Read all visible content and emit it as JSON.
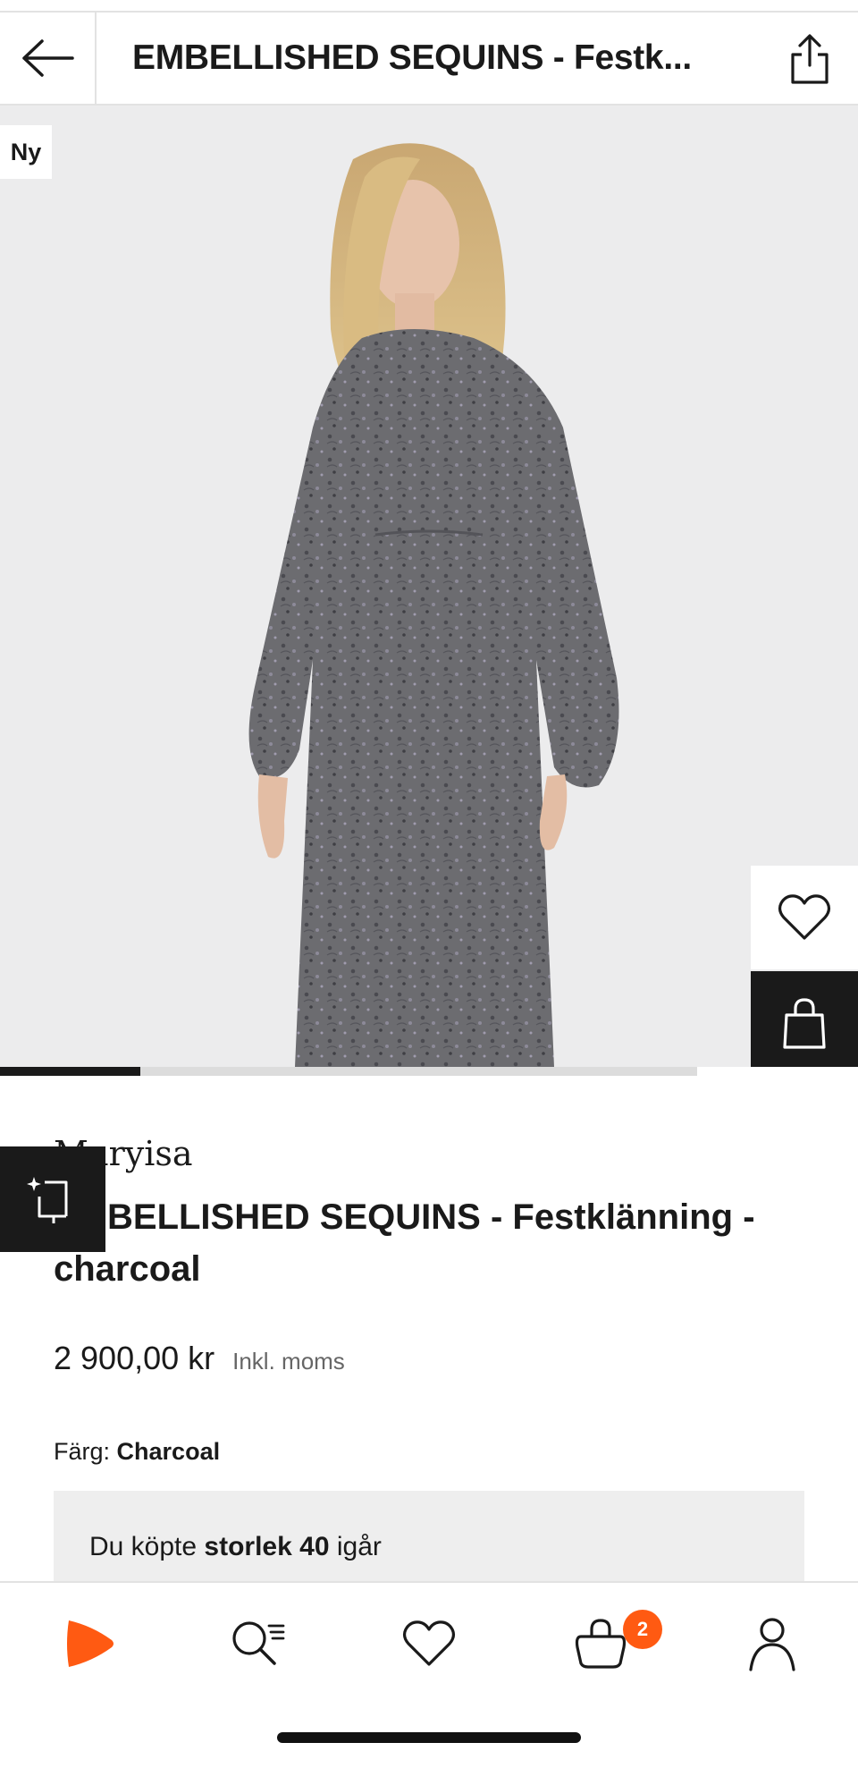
{
  "header": {
    "title": "EMBELLISHED SEQUINS - Festk...",
    "back_icon": "arrow-left-icon",
    "share_icon": "share-icon"
  },
  "gallery": {
    "badge": "Ny",
    "image_alt": "Model wearing charcoal embellished sequin long-sleeve maxi dress",
    "dress_color": "#6c6c70",
    "progress": 0.2
  },
  "product": {
    "brand": "Maryisa",
    "name": "EMBELLISHED SEQUINS - Festklänning - charcoal",
    "price": "2 900,00 kr",
    "vat_label": "Inkl. moms",
    "color_label": "Färg:",
    "color_value": "Charcoal",
    "bought_prefix": "Du köpte ",
    "bought_size": "storlek 40",
    "bought_suffix": " igår"
  },
  "tabbar": {
    "cart_count": "2",
    "accent": "#ff5a12"
  }
}
